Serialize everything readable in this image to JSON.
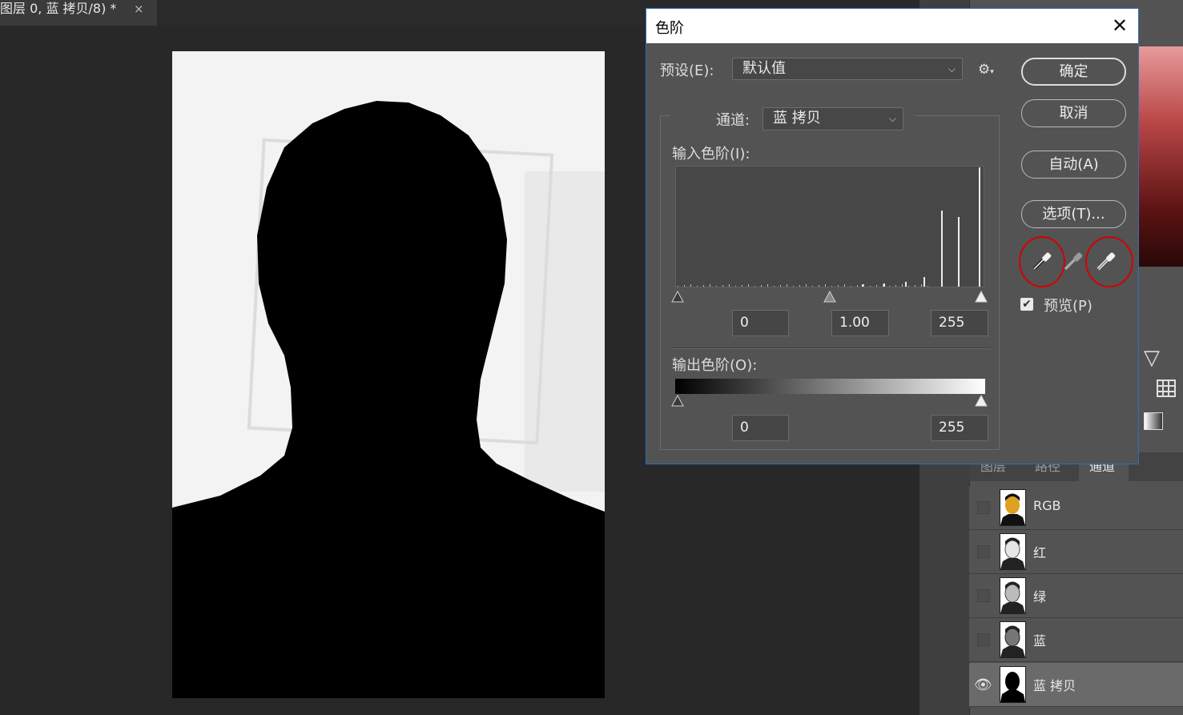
{
  "document": {
    "tab_title": "图层 0, 蓝 拷贝/8) *",
    "close_glyph": "×"
  },
  "dialog": {
    "title": "色阶",
    "close_glyph": "✕",
    "preset_label": "预设(E):",
    "preset_value": "默认值",
    "channel_label": "通道:",
    "channel_value": "蓝 拷贝",
    "input_levels_label": "输入色阶(I):",
    "input_black": "0",
    "input_gamma": "1.00",
    "input_white": "255",
    "output_levels_label": "输出色阶(O):",
    "output_black": "0",
    "output_white": "255",
    "ok_label": "确定",
    "cancel_label": "取消",
    "auto_label": "自动(A)",
    "options_label": "选项(T)...",
    "preview_label": "预览(P)",
    "preview_checked": true,
    "gear_glyph": "⚙",
    "chevron": "⌵",
    "histogram_bars": [
      {
        "pos": 0.87,
        "level": 0.63
      },
      {
        "pos": 0.925,
        "level": 0.58
      },
      {
        "pos": 0.993,
        "level": 0.99
      },
      {
        "pos": 0.81,
        "level": 0.08
      },
      {
        "pos": 0.75,
        "level": 0.04
      },
      {
        "pos": 0.68,
        "level": 0.025
      },
      {
        "pos": 0.61,
        "level": 0.018
      }
    ],
    "accent_ring_color": "#d40000"
  },
  "panel": {
    "tabs": [
      "图层",
      "路径",
      "通道"
    ],
    "channels": [
      {
        "name": "RGB",
        "visible": false,
        "selected": false
      },
      {
        "name": "红",
        "visible": false,
        "selected": false
      },
      {
        "name": "绿",
        "visible": false,
        "selected": false
      },
      {
        "name": "蓝",
        "visible": false,
        "selected": false
      },
      {
        "name": "蓝 拷贝",
        "visible": true,
        "selected": true
      }
    ]
  }
}
